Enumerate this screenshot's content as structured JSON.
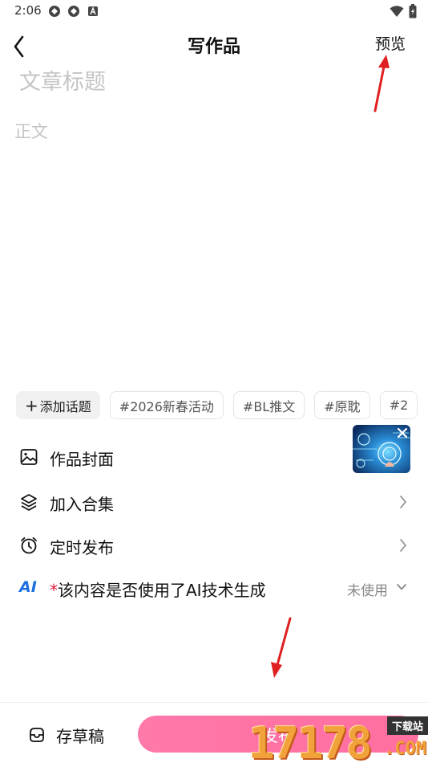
{
  "status_bar": {
    "time": "2:06",
    "icons": [
      "app-notification-icon",
      "app-notification-icon",
      "a-notification-icon",
      "wifi-icon",
      "battery-icon"
    ]
  },
  "header": {
    "back_icon": "chevron-left-icon",
    "title": "写作品",
    "preview_label": "预览"
  },
  "editor": {
    "title_placeholder": "文章标题",
    "title_value": "",
    "body_placeholder": "正文",
    "body_value": ""
  },
  "topics": {
    "add_label": "添加话题",
    "chips": [
      "#2026新春活动",
      "#BL推文",
      "#原耽",
      "#2"
    ]
  },
  "settings": {
    "cover": {
      "label": "作品封面",
      "icon": "image-icon"
    },
    "collection": {
      "label": "加入合集",
      "icon": "layers-icon"
    },
    "schedule": {
      "label": "定时发布",
      "icon": "alarm-clock-icon"
    },
    "ai": {
      "badge": "AI",
      "required_mark": "*",
      "label": "该内容是否使用了AI技术生成",
      "value": "未使用"
    }
  },
  "bottom_bar": {
    "draft_label": "存草稿",
    "publish_label": "发布"
  },
  "watermark": {
    "badge": "下载站",
    "number": "17178",
    "suffix": ".COM"
  },
  "colors": {
    "accent_pink": "#ff5b97",
    "ai_blue": "#1e6fe0",
    "required_red": "#e0173c",
    "annotation_red": "#e02020"
  }
}
